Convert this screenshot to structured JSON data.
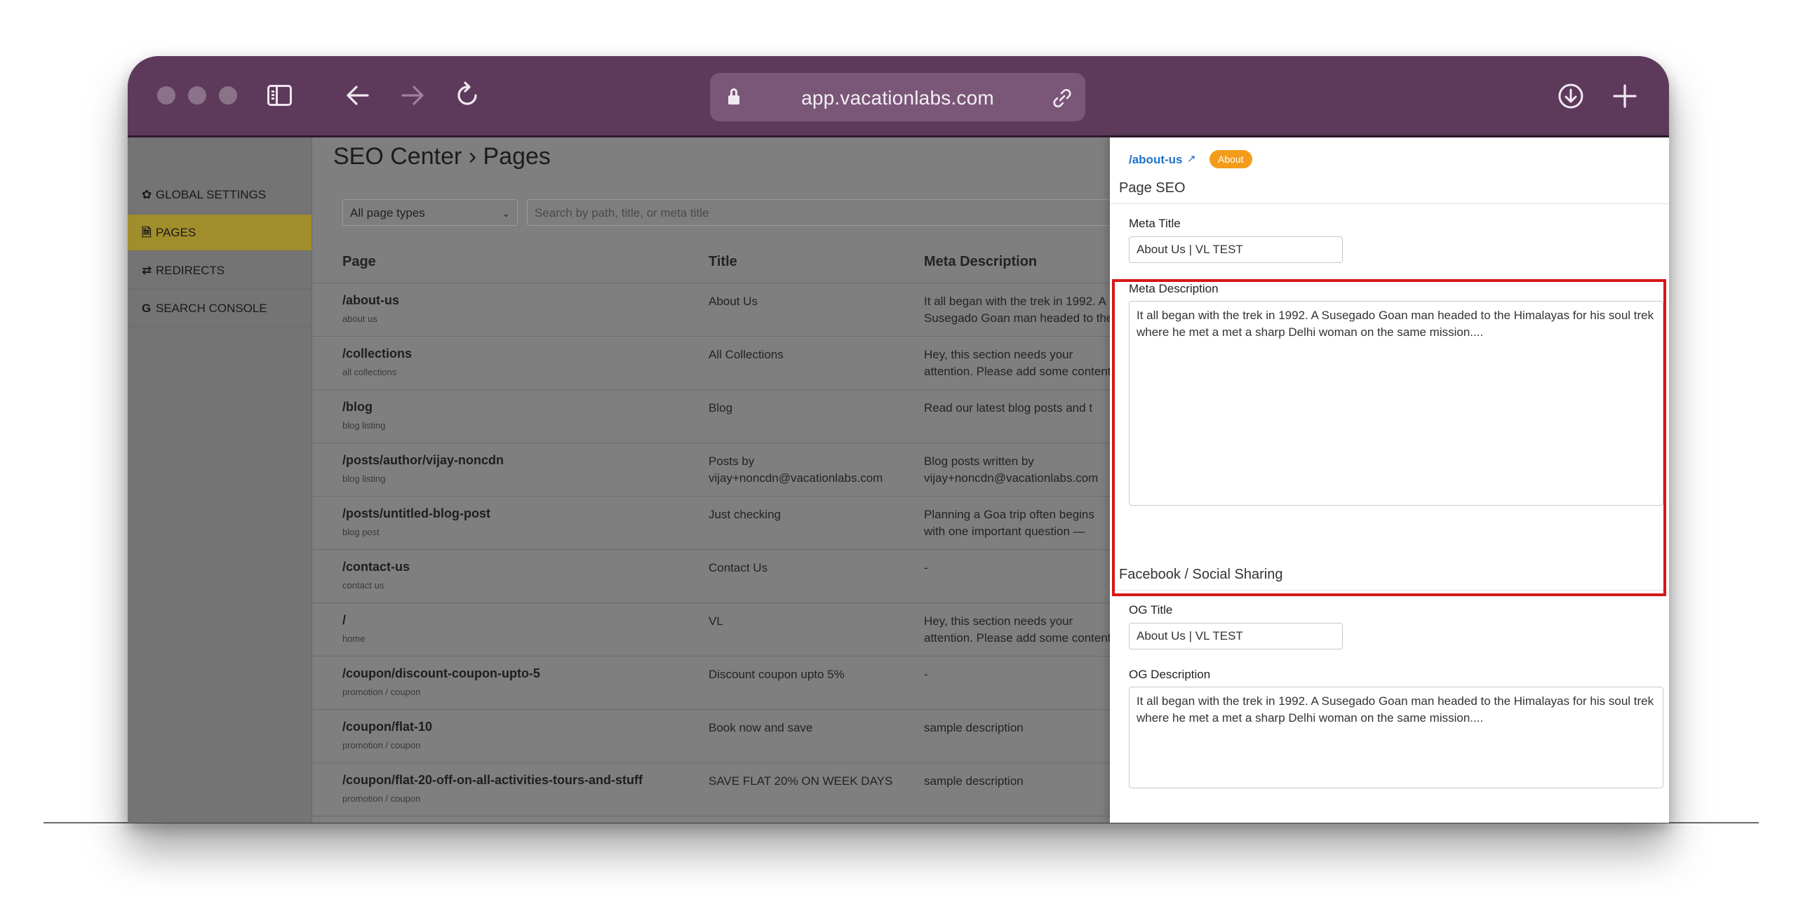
{
  "browser": {
    "url": "app.vacationlabs.com"
  },
  "nav": {
    "items": [
      {
        "label": "GLOBAL SETTINGS",
        "icon": "gear-icon"
      },
      {
        "label": "PAGES",
        "icon": "file-icon"
      },
      {
        "label": "REDIRECTS",
        "icon": "swap-icon"
      },
      {
        "label": "SEARCH CONSOLE",
        "icon": "google-g-icon"
      }
    ],
    "active_index": 1
  },
  "main": {
    "heading": "SEO Center › Pages",
    "filter_value": "All page types",
    "search_placeholder": "Search by path, title, or meta title",
    "columns": {
      "page": "Page",
      "title": "Title",
      "meta": "Meta Description"
    },
    "rows": [
      {
        "path": "/about-us",
        "sub": "about us",
        "title": "About Us",
        "meta": "It all began with the trek in 1992. A Susegado Goan man headed to the Himalayas"
      },
      {
        "path": "/collections",
        "sub": "all collections",
        "title": "All Collections",
        "meta": "Hey, this section needs your attention. Please add some content here."
      },
      {
        "path": "/blog",
        "sub": "blog listing",
        "title": "Blog",
        "meta": "Read our latest blog posts and t"
      },
      {
        "path": "/posts/author/vijay-noncdn",
        "sub": "blog listing",
        "title": "Posts by vijay+noncdn@vacationlabs.com",
        "meta": "Blog posts written by vijay+noncdn@vacationlabs.com"
      },
      {
        "path": "/posts/untitled-blog-post",
        "sub": "blog post",
        "title": "Just checking",
        "meta": "Planning a Goa trip often begins with one important question — should you"
      },
      {
        "path": "/contact-us",
        "sub": "contact us",
        "title": "Contact Us",
        "meta": "-"
      },
      {
        "path": "/",
        "sub": "home",
        "title": "VL",
        "meta": "Hey, this section needs your attention. Please add some content here."
      },
      {
        "path": "/coupon/discount-coupon-upto-5",
        "sub": "promotion / coupon",
        "title": "Discount coupon upto 5%",
        "meta": "-"
      },
      {
        "path": "/coupon/flat-10",
        "sub": "promotion / coupon",
        "title": "Book now and save",
        "meta": "sample description"
      },
      {
        "path": "/coupon/flat-20-off-on-all-activities-tours-and-stuff",
        "sub": "promotion / coupon",
        "title": "SAVE FLAT 20% ON WEEK DAYS",
        "meta": "sample description"
      }
    ]
  },
  "panel": {
    "link": "/about-us",
    "badge": "About",
    "page_seo_title": "Page SEO",
    "meta_title_label": "Meta Title",
    "meta_title_value": "About Us | VL TEST",
    "meta_desc_label": "Meta Description",
    "meta_desc_value": "It all began with the trek in 1992. A Susegado Goan man headed to the Himalayas for his soul trek where he met a met a sharp Delhi woman on the same mission....",
    "social_title": "Facebook / Social Sharing",
    "og_title_label": "OG Title",
    "og_title_value": "About Us | VL TEST",
    "og_desc_label": "OG Description",
    "og_desc_value": "It all began with the trek in 1992. A Susegado Goan man headed to the Himalayas for his soul trek where he met a met a sharp Delhi woman on the same mission...."
  },
  "colors": {
    "toolbar": "#5d3a5b",
    "active_nav": "#a08d2c",
    "link": "#1d73c9",
    "badge": "#f39c1a",
    "highlight": "#d81717"
  }
}
